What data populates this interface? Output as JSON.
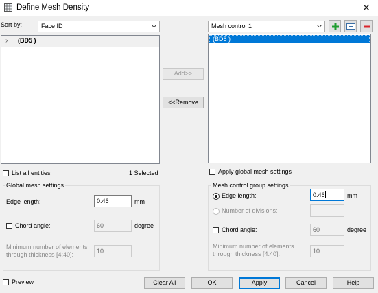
{
  "window": {
    "title": "Define Mesh Density",
    "close_glyph": "✕",
    "icon": "app-mesh-icon"
  },
  "left": {
    "sort_by_label": "Sort by:",
    "sort_by_value": "Face ID",
    "tree_item": "(BD5 )",
    "list_all_label": "List all entities",
    "selected_count": "1 Selected",
    "global_group_title": "Global mesh settings",
    "edge_length_label": "Edge length:",
    "edge_length_value": "0.46",
    "edge_length_unit": "mm",
    "chord_angle_label": "Chord angle:",
    "chord_angle_value": "60",
    "chord_angle_unit": "degree",
    "min_elements_label_1": "Minimum number of elements",
    "min_elements_label_2": "through thickness [4:40]:",
    "min_elements_value": "10"
  },
  "middle": {
    "add_label": "Add>>",
    "remove_label": "<<Remove"
  },
  "right": {
    "control_value": "Mesh control 1",
    "list_item": "(BD5 )",
    "apply_global_label": "Apply global mesh settings",
    "group_title": "Mesh control group settings",
    "edge_length_label": "Edge length:",
    "edge_length_value": "0.46",
    "edge_length_unit": "mm",
    "num_divisions_label": "Number of divisions:",
    "chord_angle_label": "Chord angle:",
    "chord_angle_value": "60",
    "chord_angle_unit": "degree",
    "min_elements_label_1": "Minimum number of elements",
    "min_elements_label_2": "through thickness [4:40]:",
    "min_elements_value": "10"
  },
  "footer": {
    "preview_label": "Preview",
    "clear_all": "Clear All",
    "ok": "OK",
    "apply": "Apply",
    "cancel": "Cancel",
    "help": "Help"
  },
  "colors": {
    "selection": "#0078d7",
    "add_green": "#1f9d2f",
    "remove_red": "#d9262c"
  }
}
